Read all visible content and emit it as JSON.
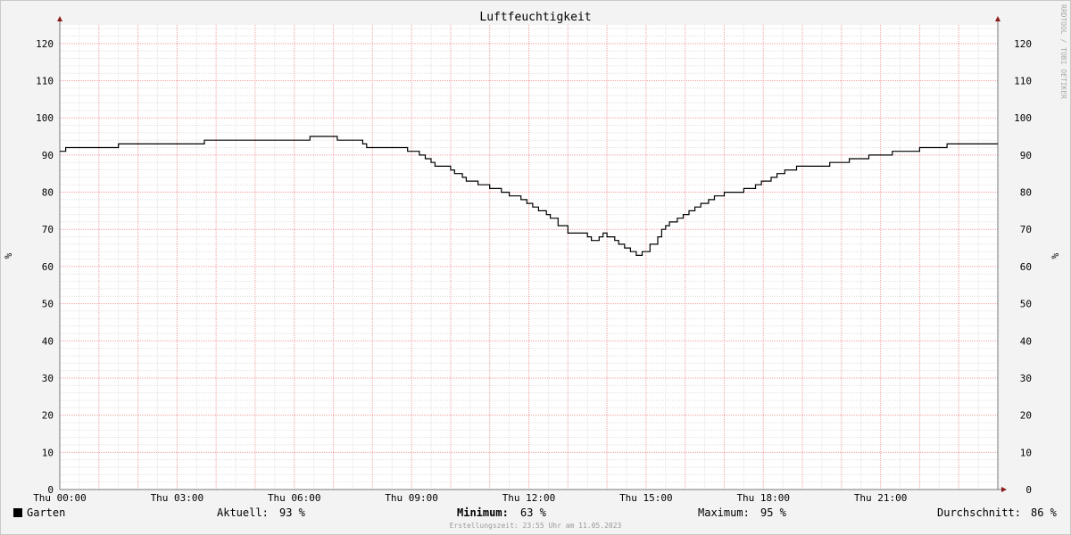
{
  "chart_data": {
    "type": "line",
    "title": "Luftfeuchtigkeit",
    "ylabel_left": "%",
    "ylabel_right": "%",
    "watermark": "RRDTOOL / TOBI OETIKER",
    "ylim": [
      0,
      125
    ],
    "xlim_hours": [
      0,
      24
    ],
    "y_ticks": [
      0,
      10,
      20,
      30,
      40,
      50,
      60,
      70,
      80,
      90,
      100,
      110,
      120
    ],
    "x_ticks": [
      {
        "hour": 0,
        "label": "Thu 00:00"
      },
      {
        "hour": 3,
        "label": "Thu 03:00"
      },
      {
        "hour": 6,
        "label": "Thu 06:00"
      },
      {
        "hour": 9,
        "label": "Thu 09:00"
      },
      {
        "hour": 12,
        "label": "Thu 12:00"
      },
      {
        "hour": 15,
        "label": "Thu 15:00"
      },
      {
        "hour": 18,
        "label": "Thu 18:00"
      },
      {
        "hour": 21,
        "label": "Thu 21:00"
      }
    ],
    "grid": true,
    "series": [
      {
        "name": "Garten",
        "color": "#000000",
        "x_hours": [
          0,
          0.15,
          1.5,
          3.7,
          6.4,
          7.1,
          7.75,
          7.85,
          8.9,
          9.2,
          9.35,
          9.5,
          9.6,
          10.0,
          10.1,
          10.3,
          10.4,
          10.7,
          11.0,
          11.3,
          11.5,
          11.8,
          11.95,
          12.1,
          12.25,
          12.45,
          12.55,
          12.75,
          13.0,
          13.5,
          13.6,
          13.8,
          13.9,
          14.0,
          14.2,
          14.3,
          14.45,
          14.6,
          14.75,
          14.9,
          15.1,
          15.3,
          15.4,
          15.5,
          15.6,
          15.8,
          15.95,
          16.1,
          16.25,
          16.4,
          16.6,
          16.75,
          17.0,
          17.5,
          17.8,
          17.95,
          18.2,
          18.35,
          18.55,
          18.75,
          18.85,
          19.25,
          19.7,
          20.2,
          20.7,
          21.3,
          22.0,
          22.7,
          23.5,
          24.0
        ],
        "values": [
          91,
          92,
          93,
          94,
          95,
          94,
          93,
          92,
          91,
          90,
          89,
          88,
          87,
          86,
          85,
          84,
          83,
          82,
          81,
          80,
          79,
          78,
          77,
          76,
          75,
          74,
          73,
          71,
          69,
          68,
          67,
          68,
          69,
          68,
          67,
          66,
          65,
          64,
          63,
          64,
          66,
          68,
          70,
          71,
          72,
          73,
          74,
          75,
          76,
          77,
          78,
          79,
          80,
          81,
          82,
          83,
          84,
          85,
          86,
          86,
          87,
          87,
          88,
          89,
          90,
          91,
          92,
          93,
          93,
          93
        ]
      }
    ]
  },
  "legend": {
    "series_name": "Garten",
    "current_label": "Aktuell:",
    "current_value": "93 %",
    "min_label": "Minimum:",
    "min_value": "63 %",
    "max_label": "Maximum:",
    "max_value": "95 %",
    "avg_label": "Durchschnitt:",
    "avg_value": "86 %"
  },
  "footer": "Erstellungszeit: 23:55 Uhr am 11.05.2023"
}
